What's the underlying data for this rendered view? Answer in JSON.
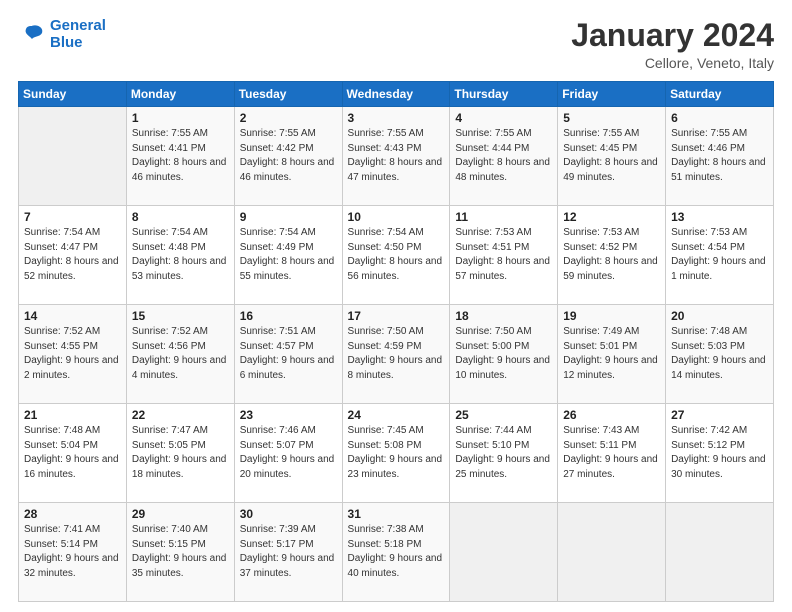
{
  "header": {
    "logo_line1": "General",
    "logo_line2": "Blue",
    "month": "January 2024",
    "location": "Cellore, Veneto, Italy"
  },
  "weekdays": [
    "Sunday",
    "Monday",
    "Tuesday",
    "Wednesday",
    "Thursday",
    "Friday",
    "Saturday"
  ],
  "weeks": [
    [
      null,
      {
        "day": 1,
        "sunrise": "7:55 AM",
        "sunset": "4:41 PM",
        "daylight": "8 hours and 46 minutes."
      },
      {
        "day": 2,
        "sunrise": "7:55 AM",
        "sunset": "4:42 PM",
        "daylight": "8 hours and 46 minutes."
      },
      {
        "day": 3,
        "sunrise": "7:55 AM",
        "sunset": "4:43 PM",
        "daylight": "8 hours and 47 minutes."
      },
      {
        "day": 4,
        "sunrise": "7:55 AM",
        "sunset": "4:44 PM",
        "daylight": "8 hours and 48 minutes."
      },
      {
        "day": 5,
        "sunrise": "7:55 AM",
        "sunset": "4:45 PM",
        "daylight": "8 hours and 49 minutes."
      },
      {
        "day": 6,
        "sunrise": "7:55 AM",
        "sunset": "4:46 PM",
        "daylight": "8 hours and 51 minutes."
      }
    ],
    [
      {
        "day": 7,
        "sunrise": "7:54 AM",
        "sunset": "4:47 PM",
        "daylight": "8 hours and 52 minutes."
      },
      {
        "day": 8,
        "sunrise": "7:54 AM",
        "sunset": "4:48 PM",
        "daylight": "8 hours and 53 minutes."
      },
      {
        "day": 9,
        "sunrise": "7:54 AM",
        "sunset": "4:49 PM",
        "daylight": "8 hours and 55 minutes."
      },
      {
        "day": 10,
        "sunrise": "7:54 AM",
        "sunset": "4:50 PM",
        "daylight": "8 hours and 56 minutes."
      },
      {
        "day": 11,
        "sunrise": "7:53 AM",
        "sunset": "4:51 PM",
        "daylight": "8 hours and 57 minutes."
      },
      {
        "day": 12,
        "sunrise": "7:53 AM",
        "sunset": "4:52 PM",
        "daylight": "8 hours and 59 minutes."
      },
      {
        "day": 13,
        "sunrise": "7:53 AM",
        "sunset": "4:54 PM",
        "daylight": "9 hours and 1 minute."
      }
    ],
    [
      {
        "day": 14,
        "sunrise": "7:52 AM",
        "sunset": "4:55 PM",
        "daylight": "9 hours and 2 minutes."
      },
      {
        "day": 15,
        "sunrise": "7:52 AM",
        "sunset": "4:56 PM",
        "daylight": "9 hours and 4 minutes."
      },
      {
        "day": 16,
        "sunrise": "7:51 AM",
        "sunset": "4:57 PM",
        "daylight": "9 hours and 6 minutes."
      },
      {
        "day": 17,
        "sunrise": "7:50 AM",
        "sunset": "4:59 PM",
        "daylight": "9 hours and 8 minutes."
      },
      {
        "day": 18,
        "sunrise": "7:50 AM",
        "sunset": "5:00 PM",
        "daylight": "9 hours and 10 minutes."
      },
      {
        "day": 19,
        "sunrise": "7:49 AM",
        "sunset": "5:01 PM",
        "daylight": "9 hours and 12 minutes."
      },
      {
        "day": 20,
        "sunrise": "7:48 AM",
        "sunset": "5:03 PM",
        "daylight": "9 hours and 14 minutes."
      }
    ],
    [
      {
        "day": 21,
        "sunrise": "7:48 AM",
        "sunset": "5:04 PM",
        "daylight": "9 hours and 16 minutes."
      },
      {
        "day": 22,
        "sunrise": "7:47 AM",
        "sunset": "5:05 PM",
        "daylight": "9 hours and 18 minutes."
      },
      {
        "day": 23,
        "sunrise": "7:46 AM",
        "sunset": "5:07 PM",
        "daylight": "9 hours and 20 minutes."
      },
      {
        "day": 24,
        "sunrise": "7:45 AM",
        "sunset": "5:08 PM",
        "daylight": "9 hours and 23 minutes."
      },
      {
        "day": 25,
        "sunrise": "7:44 AM",
        "sunset": "5:10 PM",
        "daylight": "9 hours and 25 minutes."
      },
      {
        "day": 26,
        "sunrise": "7:43 AM",
        "sunset": "5:11 PM",
        "daylight": "9 hours and 27 minutes."
      },
      {
        "day": 27,
        "sunrise": "7:42 AM",
        "sunset": "5:12 PM",
        "daylight": "9 hours and 30 minutes."
      }
    ],
    [
      {
        "day": 28,
        "sunrise": "7:41 AM",
        "sunset": "5:14 PM",
        "daylight": "9 hours and 32 minutes."
      },
      {
        "day": 29,
        "sunrise": "7:40 AM",
        "sunset": "5:15 PM",
        "daylight": "9 hours and 35 minutes."
      },
      {
        "day": 30,
        "sunrise": "7:39 AM",
        "sunset": "5:17 PM",
        "daylight": "9 hours and 37 minutes."
      },
      {
        "day": 31,
        "sunrise": "7:38 AM",
        "sunset": "5:18 PM",
        "daylight": "9 hours and 40 minutes."
      },
      null,
      null,
      null
    ]
  ],
  "labels": {
    "sunrise_prefix": "Sunrise: ",
    "sunset_prefix": "Sunset: ",
    "daylight_prefix": "Daylight: "
  }
}
